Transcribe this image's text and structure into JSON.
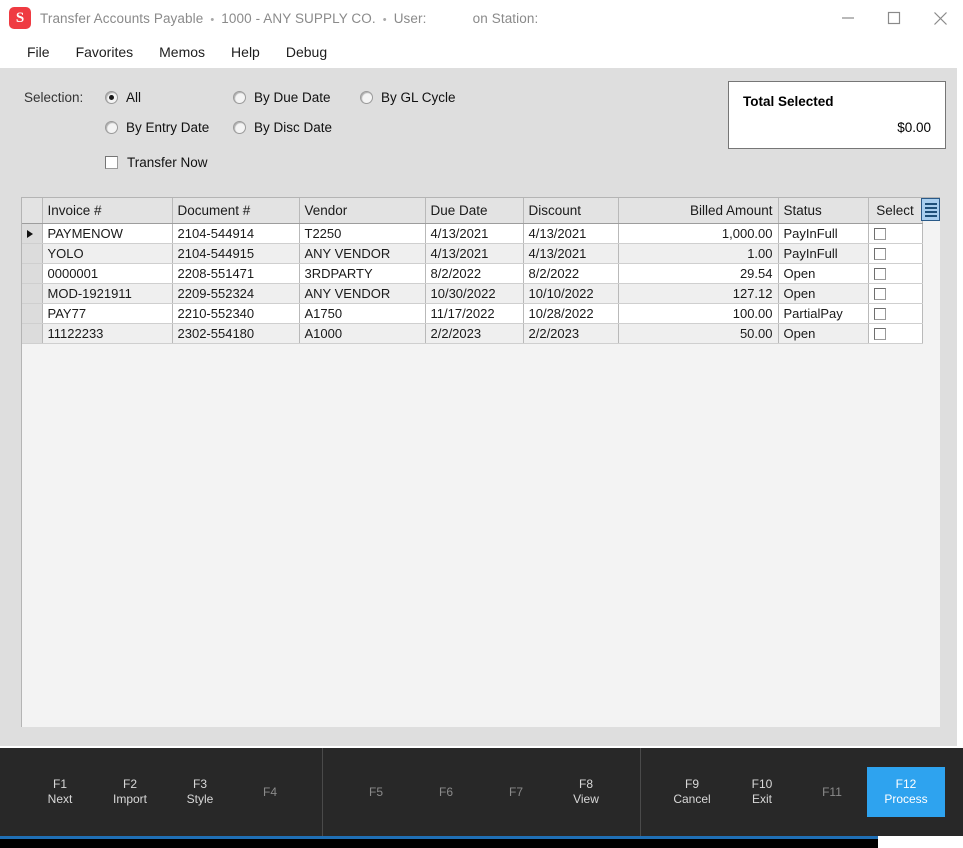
{
  "titlebar": {
    "logo_letter": "S",
    "app_title": "Transfer Accounts Payable",
    "sep1": "•",
    "company": "1000 - ANY SUPPLY CO.",
    "sep2": "•",
    "user_label": "User:",
    "user_value": "",
    "station_label": "on Station:",
    "station_value": "",
    "minimize": "minimize-icon",
    "maximize": "maximize-icon",
    "close": "close-icon"
  },
  "menubar": {
    "items": [
      {
        "label": "File"
      },
      {
        "label": "Favorites"
      },
      {
        "label": "Memos"
      },
      {
        "label": "Help"
      },
      {
        "label": "Debug"
      }
    ]
  },
  "selection": {
    "label": "Selection:",
    "options": [
      {
        "label": "All",
        "checked": true
      },
      {
        "label": "By Due Date",
        "checked": false
      },
      {
        "label": "By GL Cycle",
        "checked": false
      },
      {
        "label": "By Entry Date",
        "checked": false
      },
      {
        "label": "By Disc Date",
        "checked": false
      }
    ],
    "transfer_now": {
      "label": "Transfer Now",
      "checked": false
    }
  },
  "total_selected": {
    "title": "Total Selected",
    "value": "$0.00"
  },
  "grid": {
    "menu_button": "grid-menu-icon",
    "columns": [
      {
        "label": "Invoice #",
        "align": "left"
      },
      {
        "label": "Document #",
        "align": "left"
      },
      {
        "label": "Vendor",
        "align": "left"
      },
      {
        "label": "Due Date",
        "align": "left"
      },
      {
        "label": "Discount",
        "align": "left"
      },
      {
        "label": "Billed Amount",
        "align": "right"
      },
      {
        "label": "Status",
        "align": "left"
      },
      {
        "label": "Select",
        "align": "center"
      }
    ],
    "rows": [
      {
        "current": true,
        "invoice": "PAYMENOW",
        "document": "2104-544914",
        "vendor": "T2250",
        "due_date": "4/13/2021",
        "discount": "4/13/2021",
        "billed_amount": "1,000.00",
        "status": "PayInFull",
        "select": false
      },
      {
        "current": false,
        "invoice": "YOLO",
        "document": "2104-544915",
        "vendor": "ANY VENDOR",
        "due_date": "4/13/2021",
        "discount": "4/13/2021",
        "billed_amount": "1.00",
        "status": "PayInFull",
        "select": false
      },
      {
        "current": false,
        "invoice": "0000001",
        "document": "2208-551471",
        "vendor": "3RDPARTY",
        "due_date": "8/2/2022",
        "discount": "8/2/2022",
        "billed_amount": "29.54",
        "status": "Open",
        "select": false
      },
      {
        "current": false,
        "invoice": "MOD-1921911",
        "document": "2209-552324",
        "vendor": "ANY VENDOR",
        "due_date": "10/30/2022",
        "discount": "10/10/2022",
        "billed_amount": "127.12",
        "status": "Open",
        "select": false
      },
      {
        "current": false,
        "invoice": "PAY77",
        "document": "2210-552340",
        "vendor": "A1750",
        "due_date": "11/17/2022",
        "discount": "10/28/2022",
        "billed_amount": "100.00",
        "status": "PartialPay",
        "select": false
      },
      {
        "current": false,
        "invoice": "11122233",
        "document": "2302-554180",
        "vendor": "A1000",
        "due_date": "2/2/2023",
        "discount": "2/2/2023",
        "billed_amount": "50.00",
        "status": "Open",
        "select": false
      }
    ]
  },
  "footer": {
    "keys": [
      {
        "num": "F1",
        "label": "Next",
        "state": "active"
      },
      {
        "num": "F2",
        "label": "Import",
        "state": "active"
      },
      {
        "num": "F3",
        "label": "Style",
        "state": "active"
      },
      {
        "num": "F4",
        "label": "",
        "state": "dim"
      },
      {
        "num": "F5",
        "label": "",
        "state": "dim"
      },
      {
        "num": "F6",
        "label": "",
        "state": "dim"
      },
      {
        "num": "F7",
        "label": "",
        "state": "dim"
      },
      {
        "num": "F8",
        "label": "View",
        "state": "active"
      },
      {
        "num": "F9",
        "label": "Cancel",
        "state": "active"
      },
      {
        "num": "F10",
        "label": "Exit",
        "state": "active"
      },
      {
        "num": "F11",
        "label": "",
        "state": "dim"
      },
      {
        "num": "F12",
        "label": "Process",
        "state": "primary"
      }
    ]
  },
  "colors": {
    "accent": "#2ea3ef",
    "logo": "#ef3b42",
    "panel": "#dedede",
    "footer": "#282828"
  }
}
